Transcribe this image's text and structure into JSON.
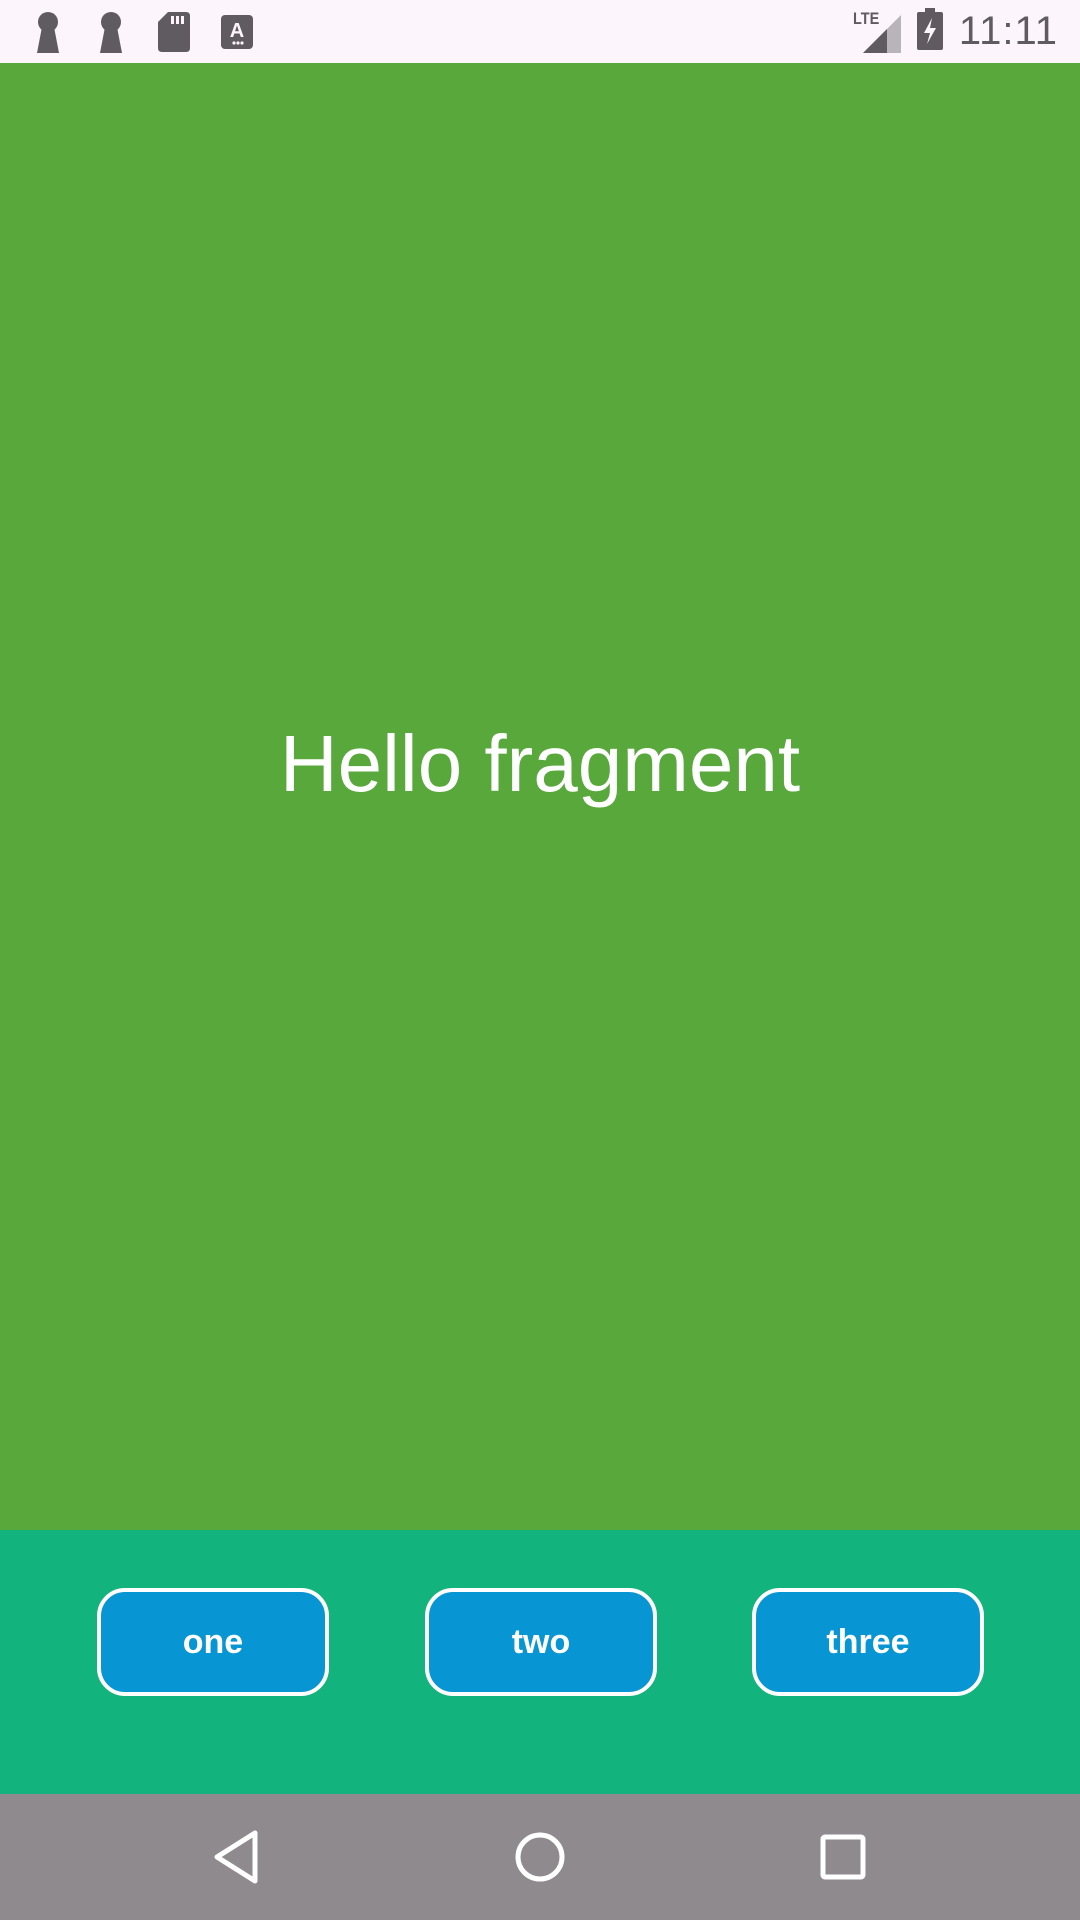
{
  "colors": {
    "status_bar_bg": "#fcf5fb",
    "fragment_bg": "#59a83c",
    "button_bar_bg": "#13b37e",
    "button_bg": "#0895d4",
    "nav_bar_bg": "#8e8a8e",
    "status_icon": "#5f5b61"
  },
  "status_bar": {
    "left_icons": [
      "keyhole-icon",
      "keyhole-icon",
      "sd-card-icon",
      "keyboard-a-icon"
    ],
    "network_label": "LTE",
    "time": "11:11"
  },
  "fragment": {
    "text": "Hello fragment"
  },
  "buttons": [
    {
      "label": "one"
    },
    {
      "label": "two"
    },
    {
      "label": "three"
    }
  ],
  "nav_bar": {
    "icons": [
      "back-icon",
      "home-icon",
      "recents-icon"
    ]
  }
}
